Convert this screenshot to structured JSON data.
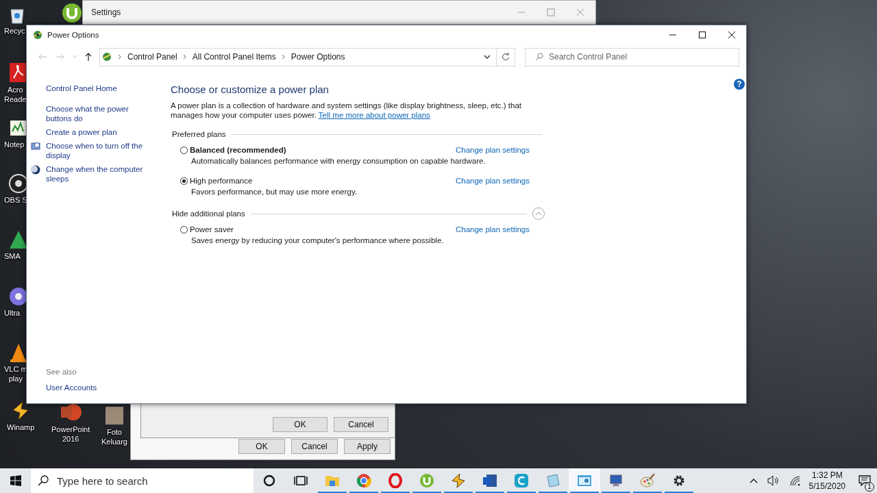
{
  "desktop_icons": [
    {
      "kind": "recycle",
      "lines": [
        "Recyc"
      ]
    },
    {
      "kind": "pdf",
      "lines": [
        "Acro",
        "Reade"
      ]
    },
    {
      "kind": "notepad",
      "lines": [
        "Notep"
      ]
    },
    {
      "kind": "obs",
      "lines": [
        "OBS S"
      ]
    },
    {
      "kind": "smart",
      "lines": [
        "SMA"
      ]
    },
    {
      "kind": "disc",
      "lines": [
        "Ultra"
      ]
    },
    {
      "kind": "cone",
      "lines": [
        "VLC m",
        "play"
      ]
    },
    {
      "kind": "bolt",
      "lines": [
        "Winamp"
      ]
    },
    {
      "kind": "slides",
      "lines": [
        "PowerPoint",
        "2016"
      ]
    },
    {
      "kind": "photo",
      "lines": [
        "Foto",
        "Keluarg"
      ]
    },
    {
      "kind": "torrent"
    }
  ],
  "back_window": {
    "title": "Settings"
  },
  "back_dialogs": [
    {
      "buttons": [
        "OK",
        "Cancel"
      ]
    },
    {
      "buttons": [
        "OK",
        "Cancel",
        "Apply"
      ]
    }
  ],
  "window": {
    "title": "Power Options",
    "address": {
      "breadcrumbs": [
        "Control Panel",
        "All Control Panel Items",
        "Power Options"
      ],
      "search_placeholder": "Search Control Panel"
    },
    "help": "?",
    "sidebar": {
      "links": [
        {
          "label": "Control Panel Home",
          "kind": "home"
        },
        {
          "label": "Choose what the power buttons do",
          "kind": "plain"
        },
        {
          "label": "Create a power plan",
          "kind": "plain"
        },
        {
          "label": "Choose when to turn off the display",
          "kind": "display"
        },
        {
          "label": "Change when the computer sleeps",
          "kind": "sleep"
        }
      ],
      "see_also": "See also",
      "see_also_links": [
        "User Accounts"
      ]
    },
    "heading": "Choose or customize a power plan",
    "description": "A power plan is a collection of hardware and system settings (like display brightness, sleep, etc.) that manages how your computer uses power.",
    "description_link": "Tell me more about power plans",
    "groups": [
      {
        "label": "Preferred plans",
        "plans": [
          {
            "name": "Balanced (recommended)",
            "emphasized": true,
            "selected": false,
            "link": "Change plan settings",
            "description": "Automatically balances performance with energy consumption on capable hardware."
          },
          {
            "name": "High performance",
            "emphasized": false,
            "selected": true,
            "link": "Change plan settings",
            "description": "Favors performance, but may use more energy."
          }
        ]
      },
      {
        "label": "Hide additional plans",
        "expanded": true,
        "plans": [
          {
            "name": "Power saver",
            "emphasized": false,
            "selected": false,
            "link": "Change plan settings",
            "description": "Saves energy by reducing your computer's performance where possible."
          }
        ]
      }
    ]
  },
  "taskbar": {
    "search_placeholder": "Type here to search",
    "apps": [
      {
        "kind": "cortana",
        "running": false,
        "active": false
      },
      {
        "kind": "taskview",
        "running": false,
        "active": false
      },
      {
        "kind": "folder",
        "running": true,
        "active": false
      },
      {
        "kind": "chrome",
        "running": true,
        "active": false
      },
      {
        "kind": "opera",
        "running": true,
        "active": false
      },
      {
        "kind": "torrent",
        "running": true,
        "active": false
      },
      {
        "kind": "bolt",
        "running": true,
        "active": false
      },
      {
        "kind": "word",
        "running": true,
        "active": false
      },
      {
        "kind": "c",
        "running": true,
        "active": false
      },
      {
        "kind": "notepad",
        "running": true,
        "active": false
      },
      {
        "kind": "panel",
        "running": true,
        "active": true
      },
      {
        "kind": "monitor",
        "running": true,
        "active": false
      },
      {
        "kind": "paint",
        "running": true,
        "active": false
      },
      {
        "kind": "gear",
        "running": true,
        "active": false
      }
    ],
    "time": "1:32 PM",
    "date": "5/15/2020",
    "notifications": "1"
  }
}
